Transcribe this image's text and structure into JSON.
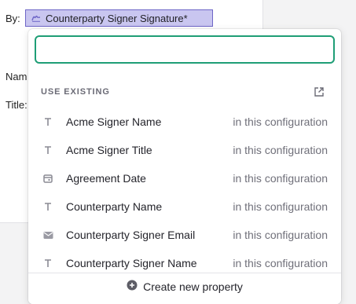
{
  "document": {
    "by_label": "By:",
    "name_label": "Nam",
    "title_label": "Title:",
    "signature_field": {
      "label": "Counterparty Signer Signature*",
      "icon": "signature-icon",
      "colors": {
        "background": "#c9c6f0",
        "border": "#6e66c7"
      }
    }
  },
  "dropdown": {
    "search": {
      "value": "",
      "placeholder": ""
    },
    "section_header": "USE EXISTING",
    "external_link_icon": "external-link-icon",
    "options": [
      {
        "label": "Acme Signer Name",
        "scope": "in this configuration",
        "icon": "text-type-icon"
      },
      {
        "label": "Acme Signer Title",
        "scope": "in this configuration",
        "icon": "text-type-icon"
      },
      {
        "label": "Agreement Date",
        "scope": "in this configuration",
        "icon": "calendar-icon"
      },
      {
        "label": "Counterparty Name",
        "scope": "in this configuration",
        "icon": "text-type-icon"
      },
      {
        "label": "Counterparty Signer Email",
        "scope": "in this configuration",
        "icon": "email-icon"
      },
      {
        "label": "Counterparty Signer Name",
        "scope": "in this configuration",
        "icon": "text-type-icon"
      }
    ],
    "create_label": "Create new property",
    "accent_color": "#1f9e76"
  }
}
